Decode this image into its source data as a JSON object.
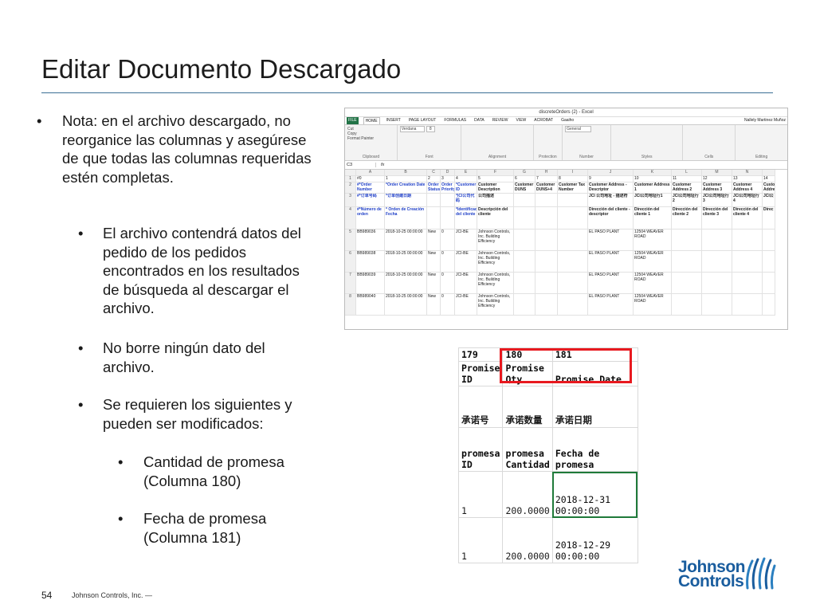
{
  "slide": {
    "title": "Editar Documento Descargado",
    "page_number": "54",
    "footer": "Johnson Controls, Inc. —"
  },
  "bullets": [
    {
      "marker": "•",
      "text": "Nota: en el archivo descargado, no reorganice las columnas y asegúrese de que todas las columnas requeridas estén completas."
    },
    {
      "marker": "•",
      "text": "El archivo contendrá datos del pedido de los pedidos encontrados en los resultados de búsqueda al descargar el archivo."
    },
    {
      "marker": "•",
      "text": "No borre ningún dato del archivo."
    },
    {
      "marker": "•",
      "text": "Se requieren los siguientes y pueden ser modificados:"
    },
    {
      "marker": "•",
      "text": "Cantidad de promesa (Columna 180)"
    },
    {
      "marker": "•",
      "text": "Fecha de promesa (Columna 181)"
    }
  ],
  "excel": {
    "window_title": "discreteOrders (2) - Excel",
    "user": "Nallely Martinez Muñoz",
    "tabs": [
      "FILE",
      "HOME",
      "INSERT",
      "PAGE LAYOUT",
      "FORMULAS",
      "DATA",
      "REVIEW",
      "VIEW",
      "ACROBAT",
      "Gaaiho"
    ],
    "groups": [
      "Clipboard",
      "Font",
      "Alignment",
      "Protection",
      "Number",
      "Styles",
      "Cells",
      "Editing"
    ],
    "font_name": "Verdana",
    "font_size": "8",
    "number_format": "General",
    "clipboard_items": [
      "Cut",
      "Copy",
      "Format Painter"
    ],
    "cell_ref": "C3",
    "columns": [
      "",
      "A",
      "B",
      "C",
      "D",
      "E",
      "F",
      "G",
      "H",
      "I",
      "J",
      "K",
      "L",
      "M",
      "N",
      ""
    ],
    "rows": [
      [
        "1",
        "#0",
        "1",
        "2",
        "3",
        "4",
        "5",
        "6",
        "7",
        "8",
        "9",
        "10",
        "11",
        "12",
        "13",
        "14"
      ],
      [
        "2",
        "#*Order Number",
        "*Order Creation Date",
        "Order Status",
        "Order Priority",
        "*Customer ID",
        "Customer Description",
        "Customer DUNS",
        "Customer DUNS+4",
        "Customer Tax Number",
        "Customer Address - Descriptor",
        "Customer Address 1",
        "Customer Address 2",
        "Customer Address 3",
        "Customer Address 4",
        "Custo Addre"
      ],
      [
        "3",
        "#*订单号码",
        "*订单创建日期",
        "",
        "",
        "*ICI公司代码",
        "公司描述",
        "",
        "",
        "",
        "JCI 公司地址 - 描述符",
        "JCI公司地址行1",
        "JCI公司地址行2",
        "JCI公司地址行3",
        "JCI公司地址行4",
        "JCI公"
      ],
      [
        "4",
        "#*Número de orden",
        "* Orden de Creación Fecha",
        "",
        "",
        "*Identificación del cliente",
        "Descripción del cliente",
        "",
        "",
        "",
        "Dirección del cliente - descriptor",
        "Dirección del cliente 1",
        "Dirección del cliente 2",
        "Dirección del cliente 3",
        "Dirección del cliente 4",
        "Direc"
      ],
      [
        "5",
        "BB989036",
        "2018-10-25 00:00:00",
        "New",
        "0",
        "JCI-BE",
        "Johnson Controls, Inc. Building Efficiency",
        "",
        "",
        "",
        "EL PASO PLANT",
        "12504 WEAVER ROAD",
        "",
        "",
        "",
        ""
      ],
      [
        "6",
        "BB989038",
        "2018-10-25 00:00:00",
        "New",
        "0",
        "JCI-BE",
        "Johnson Controls, Inc. Building Efficiency",
        "",
        "",
        "",
        "EL PASO PLANT",
        "12504 WEAVER ROAD",
        "",
        "",
        "",
        ""
      ],
      [
        "7",
        "BB989039",
        "2018-10-25 00:00:00",
        "New",
        "0",
        "JCI-BE",
        "Johnson Controls, Inc. Building Efficiency",
        "",
        "",
        "",
        "EL PASO PLANT",
        "12504 WEAVER ROAD",
        "",
        "",
        "",
        ""
      ],
      [
        "8",
        "BB989040",
        "2018-10-25 00:00:00",
        "New",
        "0",
        "JCI-BE",
        "Johnson Controls, Inc. Building Efficiency",
        "",
        "",
        "",
        "EL PASO PLANT",
        "12504 WEAVER ROAD",
        "",
        "",
        "",
        ""
      ]
    ]
  },
  "promise_table": {
    "rows": [
      [
        "179",
        "180",
        "181"
      ],
      [
        "Promise ID",
        "Promise Qty",
        "Promise Date"
      ],
      [
        "承诺号",
        "承诺数量",
        "承诺日期"
      ],
      [
        "promesa ID",
        "promesa Cantidad",
        "Fecha de promesa"
      ],
      [
        "1",
        "200.0000",
        "2018-12-31 00:00:00"
      ],
      [
        "1",
        "200.0000",
        "2018-12-29 00:00:00"
      ]
    ]
  },
  "logo": {
    "line1": "Johnson",
    "line2": "Controls"
  },
  "colors": {
    "title_rule": "#3a6f95",
    "highlight_box": "#e8191f",
    "logo_blue": "#1a5d9e",
    "excel_green": "#217346"
  }
}
